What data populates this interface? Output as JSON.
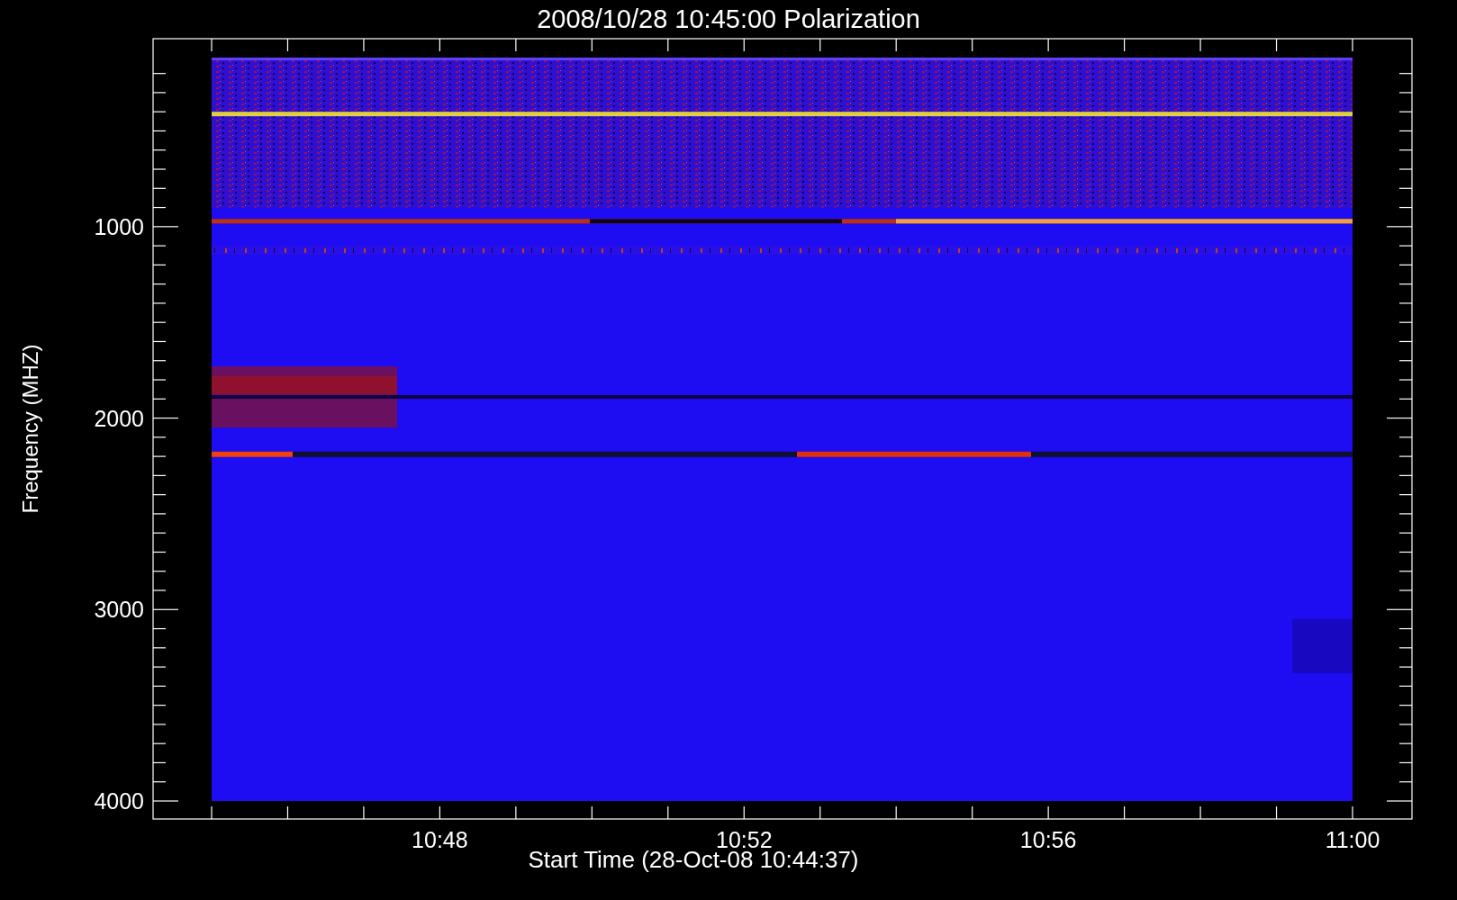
{
  "title": "2008/10/28 10:45:00 Polarization",
  "y_axis": {
    "label": "Frequency (MHZ)",
    "ticks": [
      "1000",
      "2000",
      "3000",
      "4000"
    ]
  },
  "x_axis": {
    "label": "Start Time (28-Oct-08 10:44:37)",
    "ticks": [
      "10:48",
      "10:52",
      "10:56",
      "11:00"
    ]
  }
}
